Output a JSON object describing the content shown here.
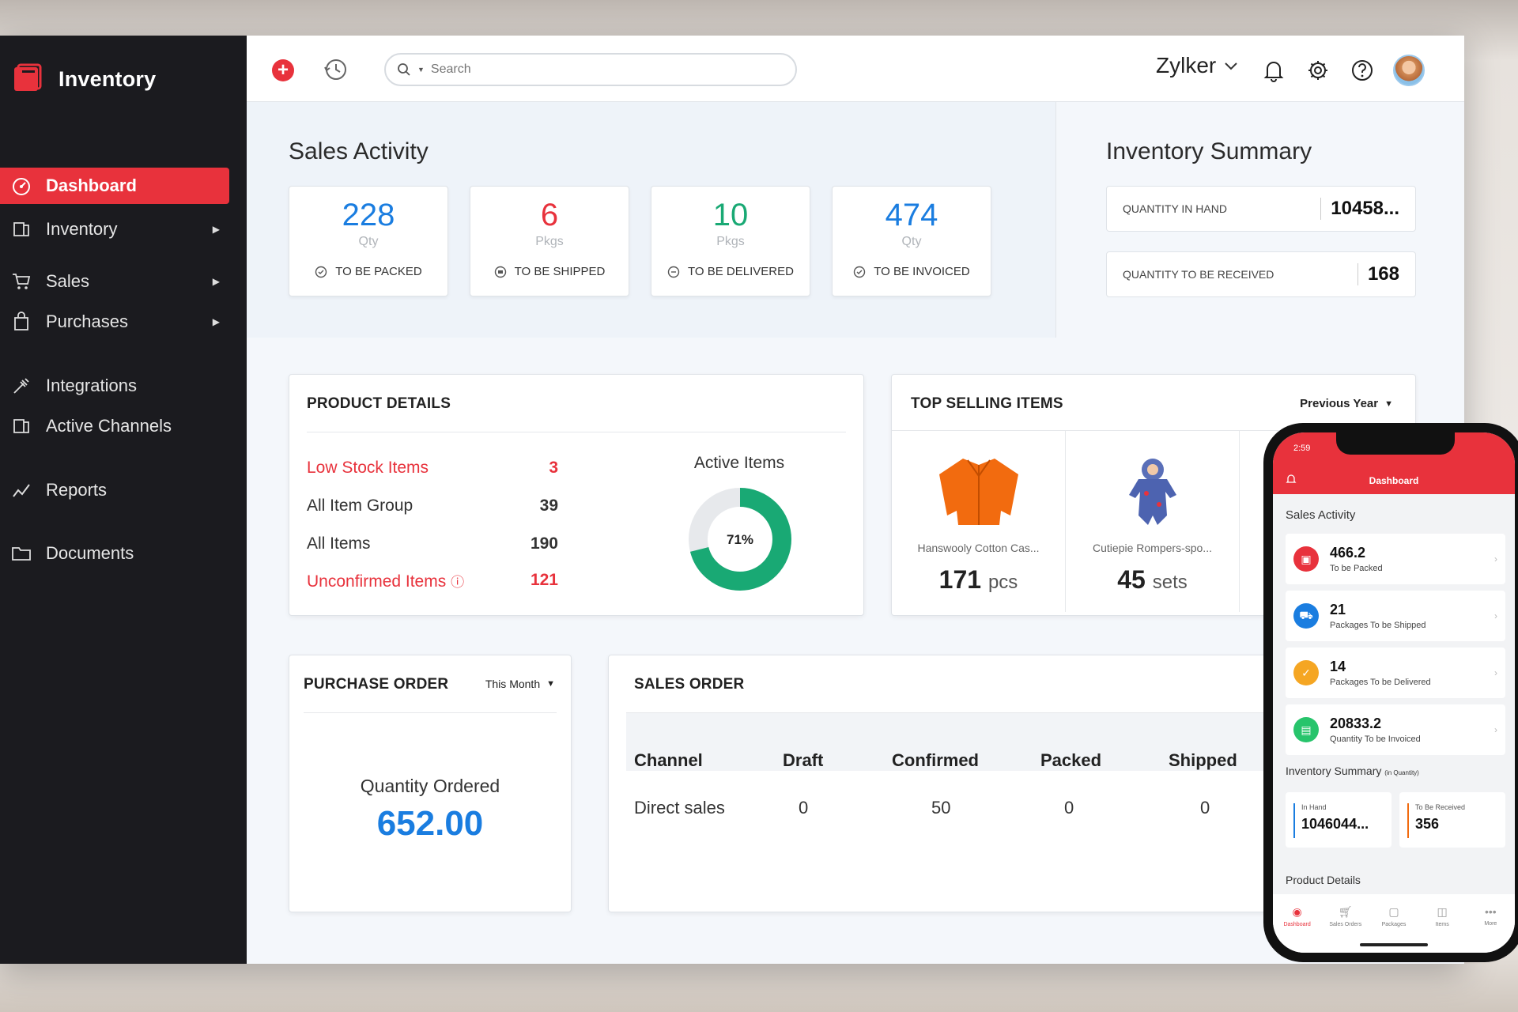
{
  "app": {
    "name": "Inventory"
  },
  "sidebar": {
    "items": [
      {
        "label": "Dashboard",
        "icon": "dashboard-icon",
        "has_submenu": false,
        "active": true
      },
      {
        "label": "Inventory",
        "icon": "inventory-icon",
        "has_submenu": true
      },
      {
        "label": "Sales",
        "icon": "cart-icon",
        "has_submenu": true
      },
      {
        "label": "Purchases",
        "icon": "bag-icon",
        "has_submenu": true
      },
      {
        "label": "Integrations",
        "icon": "plug-icon",
        "has_submenu": false
      },
      {
        "label": "Active Channels",
        "icon": "channels-icon",
        "has_submenu": false
      },
      {
        "label": "Reports",
        "icon": "chart-icon",
        "has_submenu": false
      },
      {
        "label": "Documents",
        "icon": "folder-icon",
        "has_submenu": false
      }
    ]
  },
  "topbar": {
    "search_placeholder": "Search",
    "org_name": "Zylker"
  },
  "sales_activity": {
    "title": "Sales Activity",
    "cards": [
      {
        "value": "228",
        "unit": "Qty",
        "label": "TO BE PACKED",
        "color": "#1a7de0"
      },
      {
        "value": "6",
        "unit": "Pkgs",
        "label": "TO BE SHIPPED",
        "color": "#e8323c"
      },
      {
        "value": "10",
        "unit": "Pkgs",
        "label": "TO BE DELIVERED",
        "color": "#19a974"
      },
      {
        "value": "474",
        "unit": "Qty",
        "label": "TO BE INVOICED",
        "color": "#1a7de0"
      }
    ]
  },
  "inventory_summary": {
    "title": "Inventory Summary",
    "rows": [
      {
        "label": "QUANTITY IN HAND",
        "value": "10458..."
      },
      {
        "label": "QUANTITY TO BE RECEIVED",
        "value": "168"
      }
    ]
  },
  "product_details": {
    "title": "PRODUCT DETAILS",
    "rows": [
      {
        "label": "Low Stock Items",
        "value": "3",
        "highlight": true
      },
      {
        "label": "All Item Group",
        "value": "39",
        "highlight": false
      },
      {
        "label": "All Items",
        "value": "190",
        "highlight": false
      },
      {
        "label": "Unconfirmed Items",
        "value": "121",
        "highlight": true
      }
    ],
    "active_items_title": "Active Items",
    "active_items_percent": 71,
    "active_items_label": "71%"
  },
  "top_selling": {
    "title": "TOP SELLING ITEMS",
    "period": "Previous Year",
    "items": [
      {
        "name": "Hanswooly Cotton Cas...",
        "qty": "171",
        "unit": "pcs"
      },
      {
        "name": "Cutiepie Rompers-spo...",
        "qty": "45",
        "unit": "sets"
      }
    ]
  },
  "purchase_order": {
    "title": "PURCHASE ORDER",
    "period": "This Month",
    "metric_label": "Quantity Ordered",
    "metric_value": "652.00"
  },
  "sales_order": {
    "title": "SALES ORDER",
    "columns": [
      "Channel",
      "Draft",
      "Confirmed",
      "Packed",
      "Shipped"
    ],
    "rows": [
      [
        "Direct sales",
        "0",
        "50",
        "0",
        "0"
      ]
    ]
  },
  "phone": {
    "time": "2:59",
    "title": "Dashboard",
    "sales_activity_title": "Sales Activity",
    "cards": [
      {
        "value": "466.2",
        "label": "To be Packed",
        "color": "#e8323c",
        "icon": "box-icon"
      },
      {
        "value": "21",
        "label": "Packages To be Shipped",
        "color": "#1a7de0",
        "icon": "truck-icon"
      },
      {
        "value": "14",
        "label": "Packages To be Delivered",
        "color": "#f5a623",
        "icon": "check-icon"
      },
      {
        "value": "20833.2",
        "label": "Quantity To be Invoiced",
        "color": "#27c46b",
        "icon": "invoice-icon"
      }
    ],
    "inventory_summary_title": "Inventory Summary",
    "inventory_summary_note": "(in Quantity)",
    "in_hand_label": "In Hand",
    "in_hand_value": "1046044...",
    "to_be_received_label": "To Be Received",
    "to_be_received_value": "356",
    "product_details_title": "Product Details",
    "nav": [
      "Dashboard",
      "Sales Orders",
      "Packages",
      "Items",
      "More"
    ]
  }
}
